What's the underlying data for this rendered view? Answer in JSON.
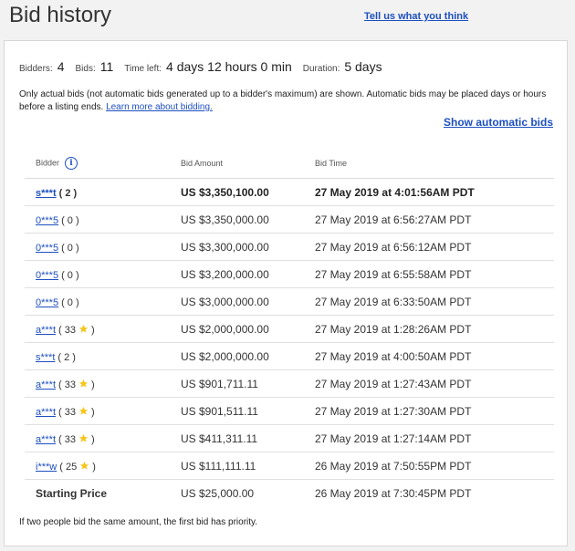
{
  "header": {
    "title": "Bid history",
    "feedback_link": "Tell us what you think"
  },
  "summary": {
    "bidders_label": "Bidders:",
    "bidders_value": "4",
    "bids_label": "Bids:",
    "bids_value": "11",
    "time_left_label": "Time left:",
    "time_left_value": "4 days 12 hours 0 min",
    "duration_label": "Duration:",
    "duration_value": "5 days"
  },
  "notice": {
    "text": "Only actual bids (not automatic bids generated up to a bidder's maximum) are shown. Automatic bids may be placed days or hours before a listing ends.",
    "link": "Learn more about bidding."
  },
  "show_automatic_bids": "Show automatic bids",
  "table": {
    "headers": {
      "bidder": "Bidder",
      "amount": "Bid Amount",
      "time": "Bid Time"
    },
    "info_icon": "i",
    "rows": [
      {
        "bidder": "s***t",
        "feedback": "( 2 )",
        "star": false,
        "amount": "US $3,350,100.00",
        "time": "27 May 2019 at 4:01:56AM PDT"
      },
      {
        "bidder": "0***5",
        "feedback": "( 0 )",
        "star": false,
        "amount": "US $3,350,000.00",
        "time": "27 May 2019 at 6:56:27AM PDT"
      },
      {
        "bidder": "0***5",
        "feedback": "( 0 )",
        "star": false,
        "amount": "US $3,300,000.00",
        "time": "27 May 2019 at 6:56:12AM PDT"
      },
      {
        "bidder": "0***5",
        "feedback": "( 0 )",
        "star": false,
        "amount": "US $3,200,000.00",
        "time": "27 May 2019 at 6:55:58AM PDT"
      },
      {
        "bidder": "0***5",
        "feedback": "( 0 )",
        "star": false,
        "amount": "US $3,000,000.00",
        "time": "27 May 2019 at 6:33:50AM PDT"
      },
      {
        "bidder": "a***t",
        "feedback": "( 33",
        "star": true,
        "amount": "US $2,000,000.00",
        "time": "27 May 2019 at 1:28:26AM PDT"
      },
      {
        "bidder": "s***t",
        "feedback": "( 2 )",
        "star": false,
        "amount": "US $2,000,000.00",
        "time": "27 May 2019 at 4:00:50AM PDT"
      },
      {
        "bidder": "a***t",
        "feedback": "( 33",
        "star": true,
        "amount": "US $901,711.11",
        "time": "27 May 2019 at 1:27:43AM PDT"
      },
      {
        "bidder": "a***t",
        "feedback": "( 33",
        "star": true,
        "amount": "US $901,511.11",
        "time": "27 May 2019 at 1:27:30AM PDT"
      },
      {
        "bidder": "a***t",
        "feedback": "( 33",
        "star": true,
        "amount": "US $411,311.11",
        "time": "27 May 2019 at 1:27:14AM PDT"
      },
      {
        "bidder": "i***w",
        "feedback": "( 25",
        "star": true,
        "amount": "US $111,111.11",
        "time": "26 May 2019 at 7:50:55PM PDT"
      }
    ],
    "starting": {
      "label": "Starting Price",
      "amount": "US $25,000.00",
      "time": "26 May 2019 at 7:30:45PM PDT"
    },
    "star_close": ")",
    "star_color": "#f5c518"
  },
  "footer_note": "If two people bid the same amount, the first bid has priority."
}
